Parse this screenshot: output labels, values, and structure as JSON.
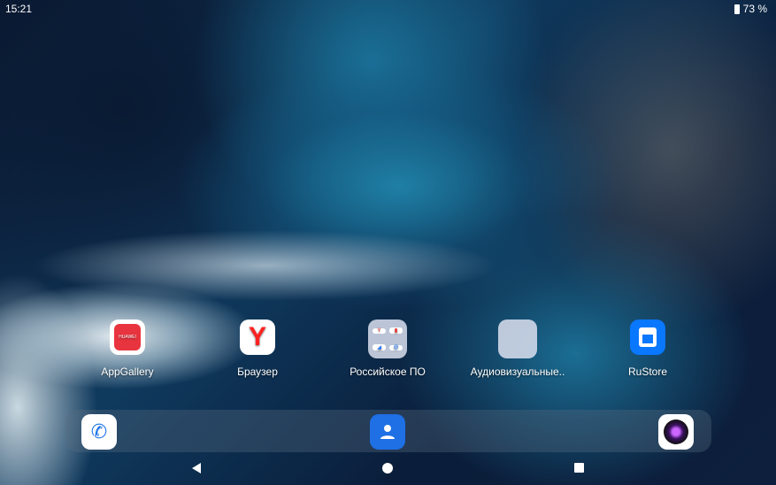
{
  "status": {
    "time": "15:21",
    "battery": "73 %"
  },
  "apps": [
    {
      "label": "AppGallery",
      "brand": "HUAWEI"
    },
    {
      "label": "Браузер",
      "glyph": "Y"
    },
    {
      "label": "Российское ПО"
    },
    {
      "label": "Аудиовизуальные.."
    },
    {
      "label": "RuStore"
    }
  ],
  "dock": [
    "phone-icon",
    "contacts-icon",
    "camera-icon"
  ]
}
